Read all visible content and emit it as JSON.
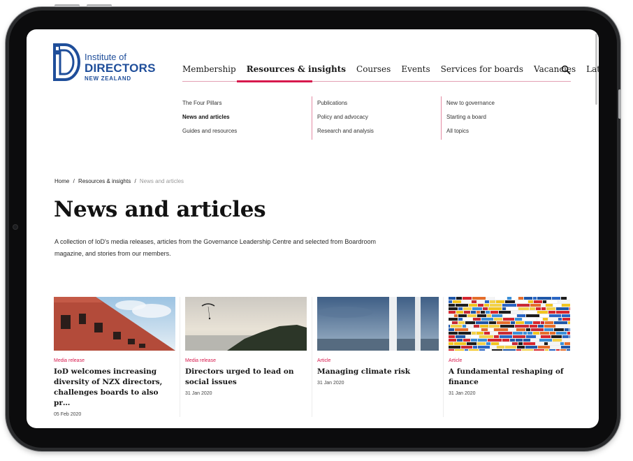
{
  "logo": {
    "line1": "Institute of",
    "line2": "DIRECTORS",
    "line3": "NEW ZEALAND"
  },
  "nav": [
    {
      "label": "Membership"
    },
    {
      "label": "Resources & insights"
    },
    {
      "label": "Courses"
    },
    {
      "label": "Events"
    },
    {
      "label": "Services for boards"
    },
    {
      "label": "Vacancies"
    },
    {
      "label": "Latest"
    }
  ],
  "mega_menu": {
    "col1": [
      "The Four Pillars",
      "News and articles",
      "Guides and resources"
    ],
    "col2": [
      "Publications",
      "Policy and advocacy",
      "Research and analysis"
    ],
    "col3": [
      "New to governance",
      "Starting a board",
      "All topics"
    ]
  },
  "breadcrumb": {
    "home": "Home",
    "sep": "/",
    "section": "Resources & insights",
    "current": "News and articles"
  },
  "page": {
    "title": "News and articles",
    "intro": "A collection of IoD's media releases, articles from the Governance Leadership Centre and selected from Boardroom magazine, and stories from our members."
  },
  "cards": [
    {
      "tag": "Media release",
      "title": "IoD welcomes increasing diversity of NZX directors, challenges boards to also pr…",
      "date": "05 Feb 2020"
    },
    {
      "tag": "Media release",
      "title": "Directors urged to lead on social issues",
      "date": "31 Jan 2020"
    },
    {
      "tag": "Article",
      "title": "Managing climate risk",
      "date": "31 Jan 2020"
    },
    {
      "tag": "Article",
      "title": "A fundamental reshaping of finance",
      "date": "31 Jan 2020"
    }
  ],
  "colors": {
    "brand_blue": "#1f4e9a",
    "accent_pink": "#d7194c"
  }
}
